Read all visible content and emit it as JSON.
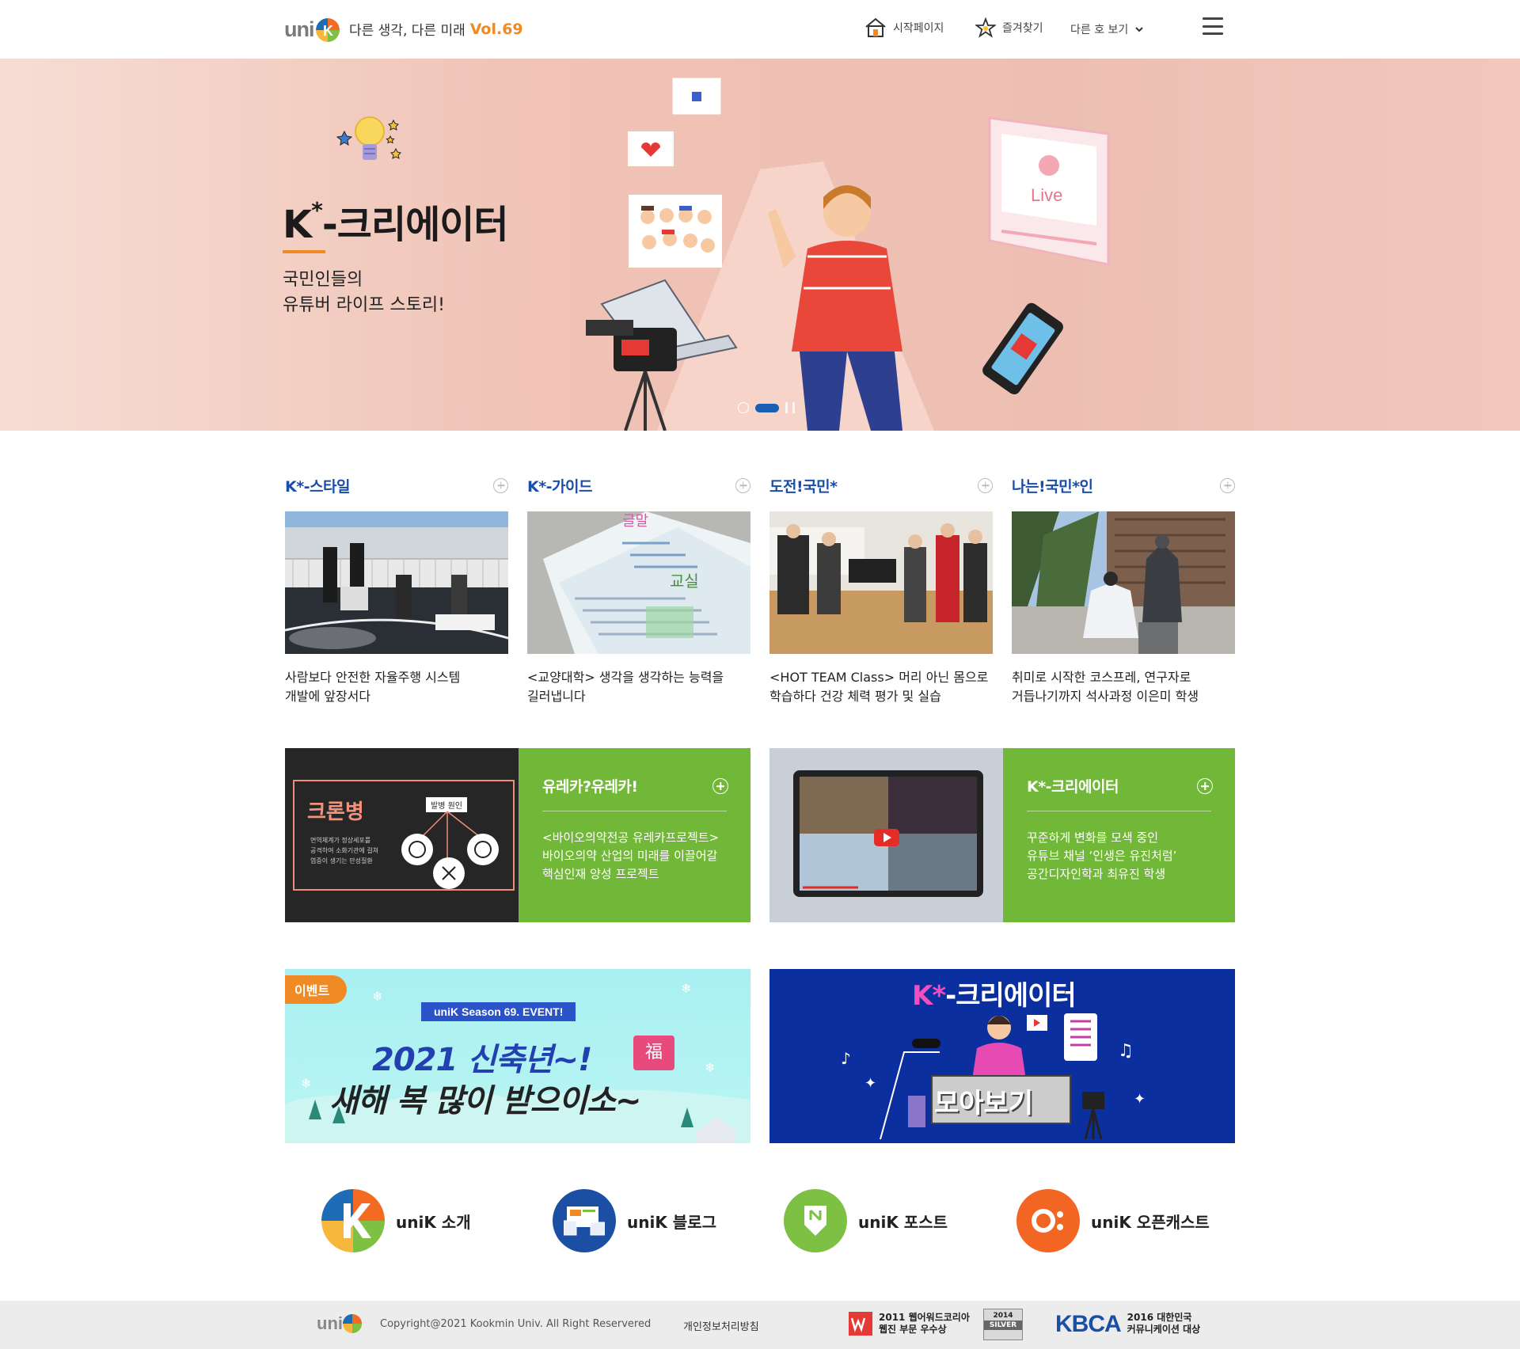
{
  "header": {
    "logo_text": "uni",
    "tagline": "다른 생각, 다른 미래",
    "volume": "Vol.69",
    "nav": {
      "home_label": "시작페이지",
      "favorite_label": "즐겨찾기",
      "other_issue_label": "다른 호 보기"
    }
  },
  "hero": {
    "title_prefix": "K",
    "title_star": "*",
    "title_main": "-크리에이터",
    "subtitle_line1": "국민인들의",
    "subtitle_line2": "유튜버 라이프 스토리!",
    "live_label": "Live"
  },
  "cards": [
    {
      "title": "K*-스타일",
      "desc_line1": "사람보다 안전한 자율주행 시스템",
      "desc_line2": "개발에 앞장서다"
    },
    {
      "title": "K*-가이드",
      "desc_line1": "<교양대학> 생각을 생각하는 능력을",
      "desc_line2": "길러냅니다"
    },
    {
      "title": "도전!국민*",
      "desc_line1": "<HOT TEAM Class> 머리 아닌 몸으로",
      "desc_line2": "학습하다 건강 체력 평가 및 실습"
    },
    {
      "title": "나는!국민*인",
      "desc_line1": "취미로 시작한 코스프레, 연구자로",
      "desc_line2": "거듭나기까지 석사과정 이은미 학생"
    }
  ],
  "features": [
    {
      "title": "유레카?유레카!",
      "desc_line1": "<바이오의약전공 유레카프로젝트>",
      "desc_line2": "바이오의약 산업의 미래를 이끌어갈",
      "desc_line3": "핵심인재 양성 프로젝트",
      "image_title": "크론병",
      "image_tag": "발병 원인",
      "image_text1": "면역체계가 정상세포를",
      "image_text2": "공격하여 소화기관에 걸쳐",
      "image_text3": "염증이 생기는 만성질환"
    },
    {
      "title": "K*-크리에이터",
      "desc_line1": "꾸준하게 변화를 모색 중인",
      "desc_line2": "유튜브 채널 ‘인생은 유진처럼’",
      "desc_line3": "공간디자인학과 최유진 학생"
    }
  ],
  "banners": {
    "event": {
      "badge": "이벤트",
      "ribbon": "uniK Season 69. EVENT!",
      "line1": "2021 신축년~!",
      "line2": "새해 복 많이 받으이소~",
      "fortune_char": "福"
    },
    "creator": {
      "title_k": "K",
      "title_star": "*",
      "title_main": "-크리에이터",
      "moa_label": "모아보기"
    }
  },
  "links": [
    {
      "label": "uniK 소개",
      "icon": "unik-logo-icon"
    },
    {
      "label": "uniK 블로그",
      "icon": "blog-icon"
    },
    {
      "label": "uniK 포스트",
      "icon": "post-icon"
    },
    {
      "label": "uniK 오픈캐스트",
      "icon": "opencast-icon"
    }
  ],
  "footer": {
    "logo_text": "uni",
    "copyright": "Copyright@2021 Kookmin Univ. All Right Reservered",
    "privacy": "개인정보처리방침",
    "award1_line1": "2011 웹어워드코리아",
    "award1_line2": "웹진 부문 우수상",
    "award2_year": "2014",
    "award2_label": "SILVER",
    "award3_logo": "KBCA",
    "award3_line1": "2016 대한민국",
    "award3_line2": "커뮤니케이션 대상"
  },
  "colors": {
    "accent_orange": "#f08a24",
    "title_blue": "#1a4da8",
    "feature_green": "#72b838",
    "creator_banner_blue": "#0c2fa0",
    "event_banner_cyan": "#a9f0f2"
  }
}
